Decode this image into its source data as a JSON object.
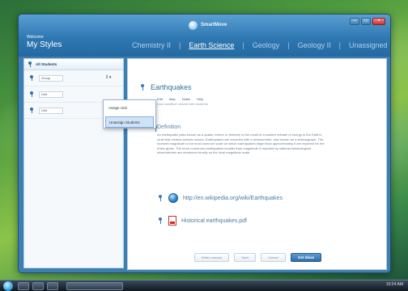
{
  "app": {
    "brand_name": "SmartMove",
    "welcome": "Welcome",
    "user_name": "My Styles"
  },
  "tabs": [
    "Chemistry II",
    "Earth Science",
    "Geology",
    "Geology II",
    "Unassigned"
  ],
  "active_tab_index": 1,
  "sidebar": {
    "header": "All Students",
    "rows": [
      {
        "label": "Group",
        "dropdown": "3"
      },
      {
        "label": "Unit"
      },
      {
        "label": "Unit"
      }
    ]
  },
  "dropdown_menu": {
    "items": [
      "Assign Unit",
      "Unassign Students"
    ],
    "selected_index": 1
  },
  "content": {
    "topic_title": "Earthquakes",
    "tags": [
      "Edit",
      "Map",
      "Notes",
      "Help"
    ],
    "meta": "Last modified: shared with students",
    "definition_label": "Definition",
    "definition_text": "An earthquake (also known as a quake, tremor or temblor) is the result of a sudden release of energy in the Earth's crust that creates seismic waves. Earthquakes are recorded with a seismometer, also known as a seismograph. The moment magnitude is the most common scale on which earthquakes larger than approximately 5 are reported for the entire globe. The more numerous earthquakes smaller than magnitude 5 reported by national seismological observatories are measured mostly on the local magnitude scale.",
    "resources": [
      {
        "type": "link",
        "icon": "globe-icon",
        "text": "http://en.wikipedia.org/wiki/Earthquakes"
      },
      {
        "type": "file",
        "icon": "pdf-icon",
        "text": "Historical earthquakes.pdf"
      }
    ]
  },
  "footer": {
    "buttons": [
      "Write Lessons",
      "Save",
      "Cancel",
      "Get Ideas"
    ]
  },
  "taskbar": {
    "clock": "10:24 AM"
  },
  "colors": {
    "accent": "#2f78b2",
    "primary_button": "#2f6ea8"
  }
}
